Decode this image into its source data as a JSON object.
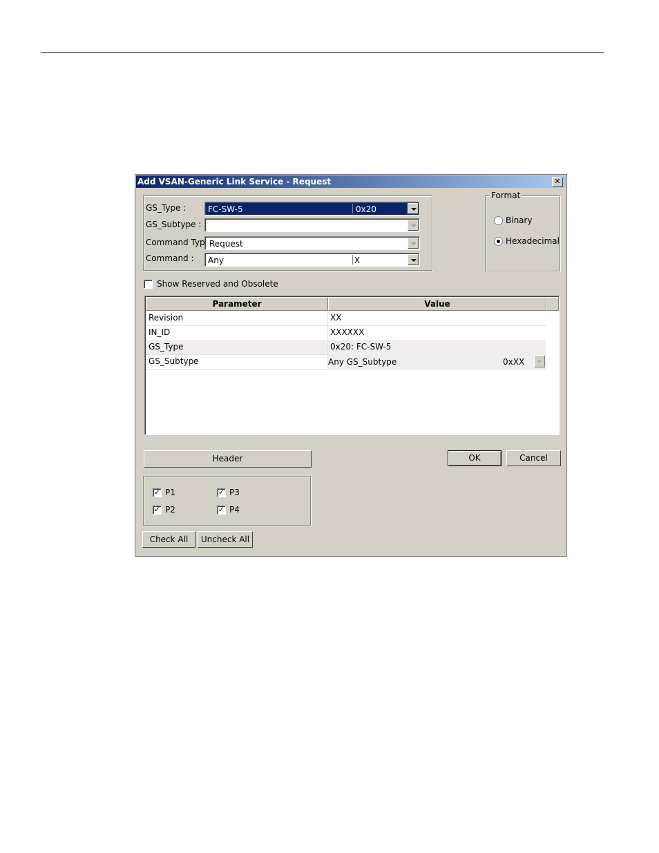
{
  "dialog": {
    "title": "Add VSAN-Generic Link Service - Request",
    "close_symbol": "✕"
  },
  "fields": {
    "gs_type_label": "GS_Type :",
    "gs_type_value": "FC-SW-5",
    "gs_type_code": "0x20",
    "gs_subtype_label": "GS_Subtype :",
    "gs_subtype_value": "",
    "command_type_label": "Command Type:",
    "command_type_value": "Request",
    "command_label": "Command :",
    "command_value": "Any",
    "command_code": "X"
  },
  "format": {
    "legend": "Format",
    "options": [
      "Binary",
      "Hexadecimal"
    ],
    "selected": "Hexadecimal"
  },
  "show_reserved": {
    "label": "Show Reserved and Obsolete",
    "checked": false
  },
  "table": {
    "columns": [
      "Parameter",
      "Value"
    ],
    "rows": [
      {
        "parameter": "Revision",
        "value": "XX"
      },
      {
        "parameter": "IN_ID",
        "value": "XXXXXX"
      },
      {
        "parameter": "GS_Type",
        "value": "0x20: FC-SW-5"
      },
      {
        "parameter": "GS_Subtype",
        "value": "Any GS_Subtype",
        "code": "0xXX"
      }
    ]
  },
  "buttons": {
    "header": "Header",
    "ok": "OK",
    "cancel": "Cancel",
    "check_all": "Check All",
    "uncheck_all": "Uncheck All"
  },
  "ports": [
    {
      "label": "P1",
      "checked": true
    },
    {
      "label": "P3",
      "checked": true
    },
    {
      "label": "P2",
      "checked": true
    },
    {
      "label": "P4",
      "checked": true
    }
  ],
  "check_mark": "✓",
  "colors": {
    "title_start": "#0a246a",
    "title_end": "#a6caf0",
    "dialog_bg": "#d4d0c8",
    "selection": "#0a246a"
  }
}
